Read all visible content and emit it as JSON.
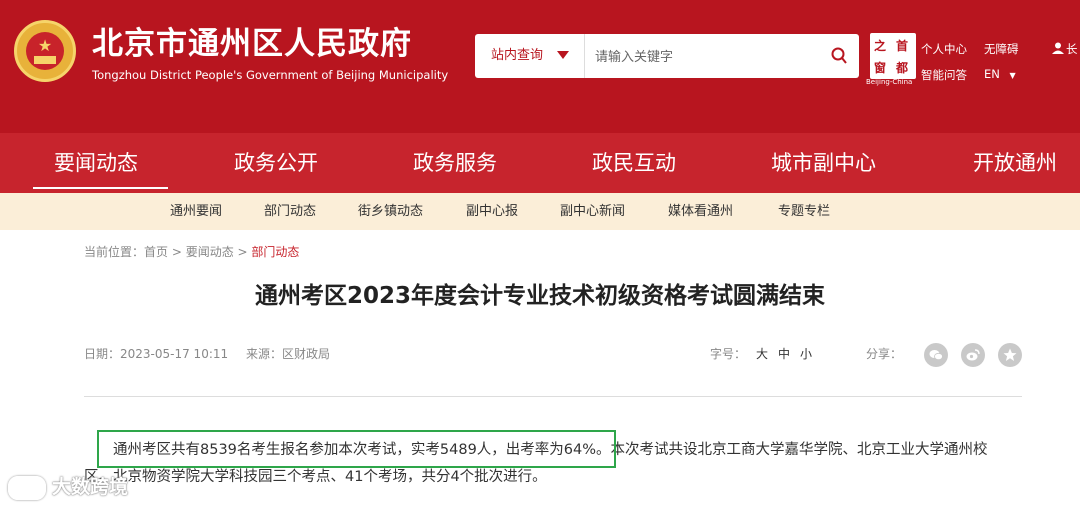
{
  "header": {
    "site_title": "北京市通州区人民政府",
    "site_subtitle": "Tongzhou District People's Government of Beijing Municipality",
    "search_scope": "站内查询",
    "search_placeholder": "请输入关键字",
    "badge": {
      "c1": "之",
      "c2": "首",
      "c3": "窗",
      "c4": "都",
      "caption": "Beijing-China"
    },
    "links": {
      "personal": "个人中心",
      "accessible": "无障碍",
      "smart_qa": "智能问答",
      "language": "EN",
      "user": "长"
    }
  },
  "nav": {
    "items": [
      "要闻动态",
      "政务公开",
      "政务服务",
      "政民互动",
      "城市副中心",
      "开放通州"
    ],
    "active": 0
  },
  "subnav": {
    "items": [
      "通州要闻",
      "部门动态",
      "街乡镇动态",
      "副中心报",
      "副中心新闻",
      "媒体看通州",
      "专题专栏"
    ]
  },
  "breadcrumb": {
    "label": "当前位置：",
    "home": "首页",
    "sep1": " > ",
    "section": "要闻动态",
    "sep2": " > ",
    "current": "部门动态"
  },
  "article": {
    "title": "通州考区2023年度会计专业技术初级资格考试圆满结束",
    "date": "日期：2023-05-17 10:11",
    "source": "来源：区财政局",
    "font_label": "字号：",
    "font_sizes": [
      "大",
      "中",
      "小"
    ],
    "share_label": "分享：",
    "para_line1_highlight": "通州考区共有8539名考生报名参加本次考试，实考5489人，出考率为64%。",
    "para_line1_rest": "本次考试共设北京工商大学嘉华学院、北京工业大学通州校",
    "para_line2": "区、北京物资学院大学科技园三个考点、41个考场，共分4个批次进行。"
  },
  "watermark": "大数跨境",
  "colors": {
    "brand_red": "#b8151f",
    "nav_red": "#c7242d",
    "subnav_bg": "#fbeed8",
    "highlight_green": "#2ea64a"
  }
}
